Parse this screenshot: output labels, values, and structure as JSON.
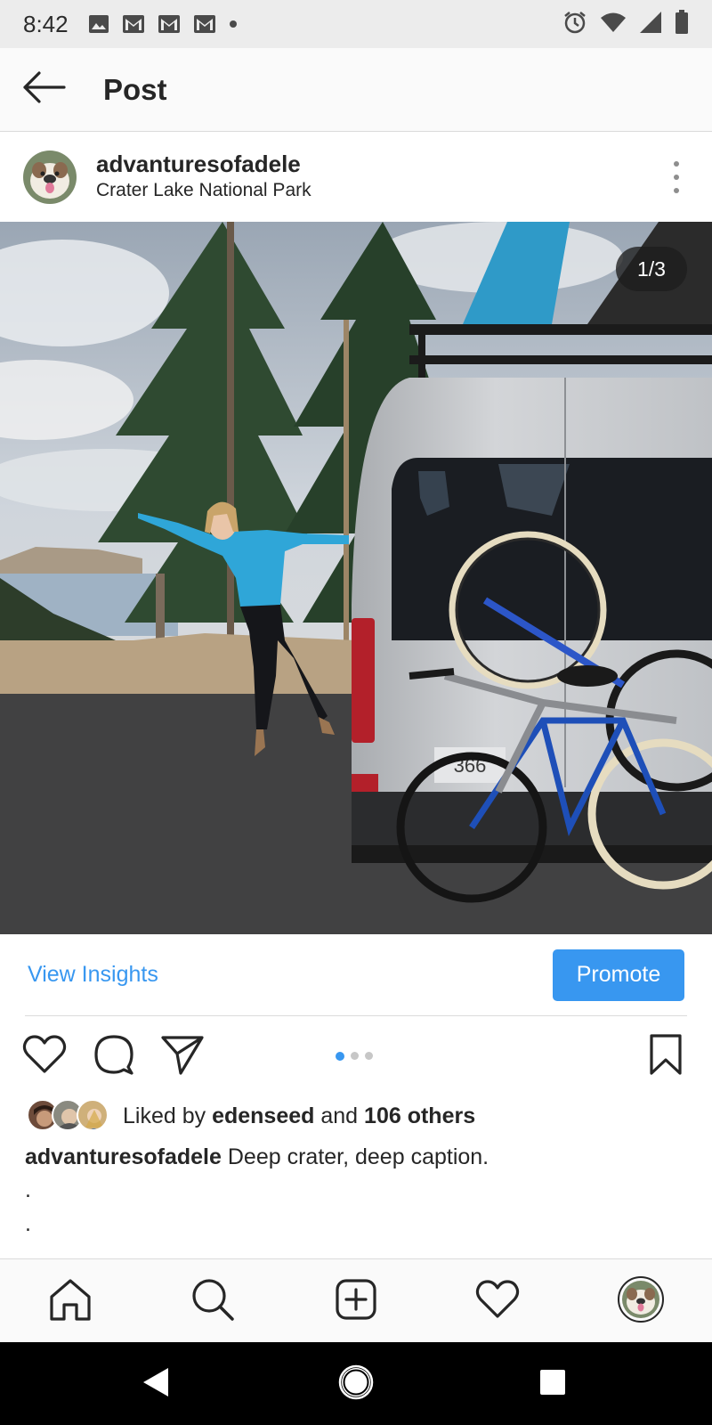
{
  "status_bar": {
    "time": "8:42",
    "left_icons": [
      "image-icon",
      "gmail-icon",
      "gmail-icon",
      "gmail-icon",
      "dot-icon"
    ],
    "right_icons": [
      "alarm-icon",
      "wifi-icon",
      "signal-icon",
      "battery-icon"
    ]
  },
  "app_bar": {
    "title": "Post",
    "back_icon": "arrow-left-icon"
  },
  "post": {
    "username": "advanturesofadele",
    "location": "Crater Lake National Park",
    "image_counter": "1/3",
    "image_index": 1,
    "image_total": 3
  },
  "insights": {
    "view_label": "View Insights",
    "promote_label": "Promote"
  },
  "actions": {
    "icons": [
      "heart-icon",
      "comment-icon",
      "share-icon",
      "bookmark-icon"
    ]
  },
  "likes": {
    "prefix": "Liked by",
    "first_liker": "edenseed",
    "conjunction": "and",
    "others": "106 others"
  },
  "caption": {
    "username": "advanturesofadele",
    "text": "Deep crater, deep caption.",
    "continuation": [
      ".",
      ".",
      "."
    ]
  },
  "bottom_nav": {
    "items": [
      "home-icon",
      "search-icon",
      "new-post-icon",
      "activity-icon",
      "profile-icon"
    ]
  },
  "colors": {
    "accent": "#3897f0",
    "text": "#262626",
    "jacket": "#2fa6d8"
  }
}
